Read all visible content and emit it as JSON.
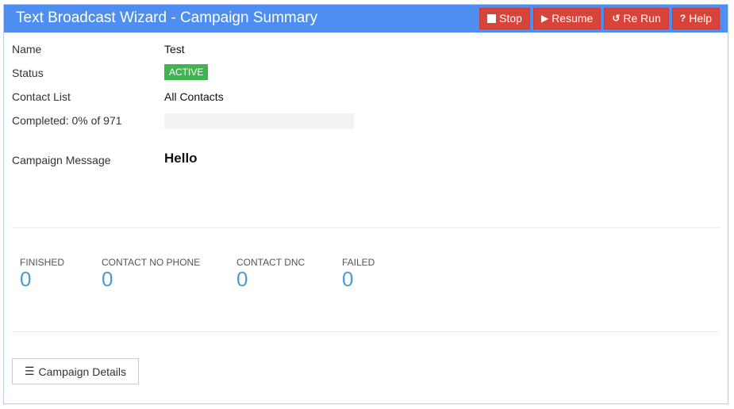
{
  "header": {
    "title": "Text Broadcast Wizard - Campaign Summary",
    "buttons": [
      {
        "label": "Stop",
        "icon": "stop-icon"
      },
      {
        "label": "Resume",
        "icon": "play-icon"
      },
      {
        "label": "Re Run",
        "icon": "rerun-icon"
      },
      {
        "label": "Help",
        "icon": "help-icon"
      }
    ]
  },
  "summary": {
    "name_label": "Name",
    "name_value": "Test",
    "status_label": "Status",
    "status_value": "ACTIVE",
    "contact_list_label": "Contact List",
    "contact_list_value": "All Contacts",
    "completed_label": "Completed: 0% of 971",
    "completed_percent": 0,
    "message_label": "Campaign Message",
    "message_value": "Hello"
  },
  "colors": {
    "header": "#4d8ef0",
    "button": "#d9443a",
    "active": "#3fb44f",
    "stat_number": "#4a9ad8"
  },
  "stats": [
    {
      "label": "FINISHED",
      "value": "0"
    },
    {
      "label": "CONTACT NO PHONE",
      "value": "0"
    },
    {
      "label": "CONTACT DNC",
      "value": "0"
    },
    {
      "label": "FAILED",
      "value": "0"
    }
  ],
  "footer": {
    "details_label": "Campaign Details"
  }
}
